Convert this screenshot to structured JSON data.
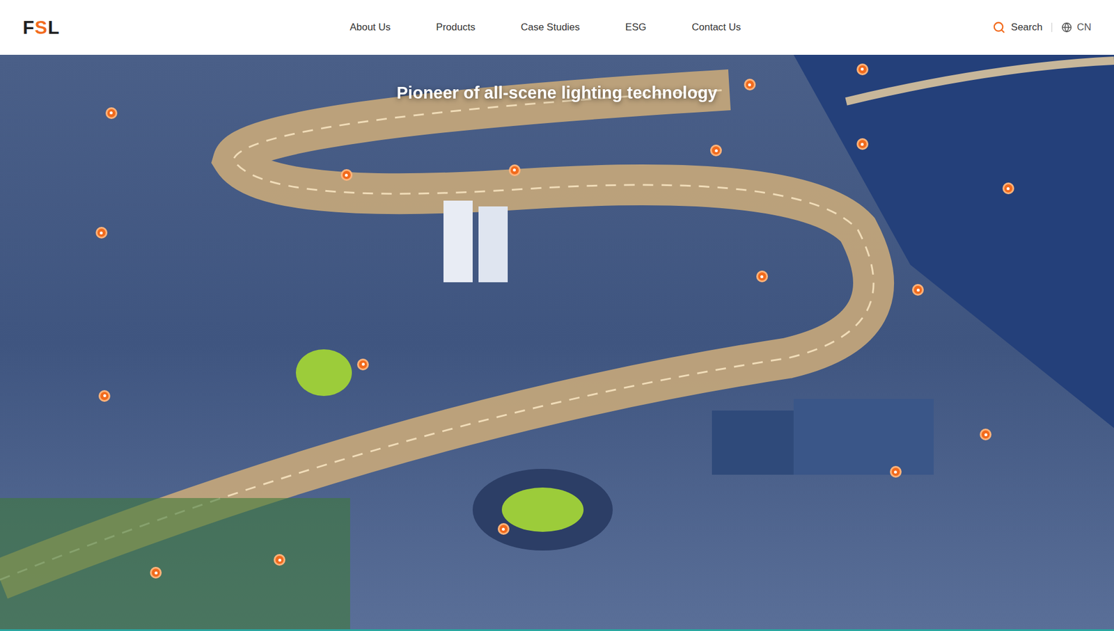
{
  "header": {
    "logo": [
      {
        "text": "F",
        "color": "#1f1f1f"
      },
      {
        "text": "S",
        "color": "#f26b1d"
      },
      {
        "text": "L",
        "color": "#1f1f1f"
      }
    ],
    "nav": [
      {
        "label": "About Us",
        "selected": false
      },
      {
        "label": "Products",
        "selected": false
      },
      {
        "label": "Case Studies",
        "selected": false
      },
      {
        "label": "ESG",
        "selected": false
      },
      {
        "label": "Contact Us",
        "selected": false
      }
    ],
    "search": "Search",
    "language": "CN"
  },
  "hero": {
    "title": "Pioneer of all-scene lighting technology"
  }
}
